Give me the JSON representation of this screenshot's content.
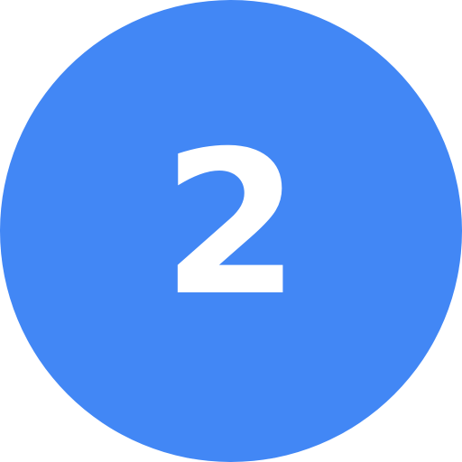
{
  "badge": {
    "number": "2",
    "fill_color": "#4287F5",
    "text_color": "#FFFFFF"
  }
}
